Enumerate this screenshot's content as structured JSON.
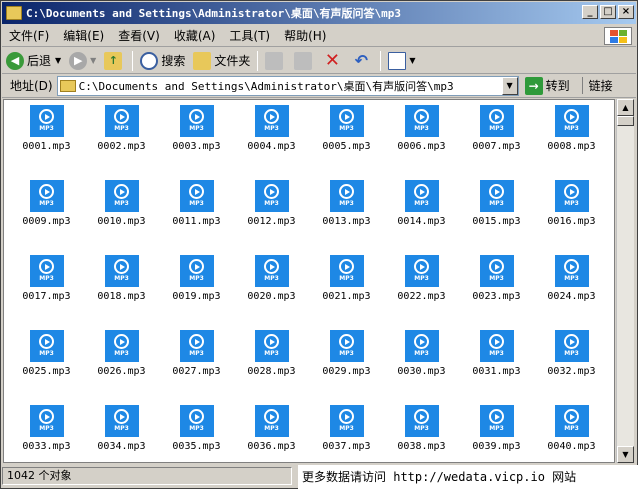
{
  "window": {
    "title": "C:\\Documents and Settings\\Administrator\\桌面\\有声版问答\\mp3",
    "buttons": [
      "_",
      "□",
      "×"
    ]
  },
  "menu": [
    "文件(F)",
    "编辑(E)",
    "查看(V)",
    "收藏(A)",
    "工具(T)",
    "帮助(H)"
  ],
  "toolbar": {
    "back": "后退",
    "search": "搜索",
    "folders": "文件夹"
  },
  "address": {
    "label": "地址(D)",
    "value": "C:\\Documents and Settings\\Administrator\\桌面\\有声版问答\\mp3",
    "go": "转到",
    "links": "链接"
  },
  "icon_label": "MP3",
  "files": [
    "0001.mp3",
    "0002.mp3",
    "0003.mp3",
    "0004.mp3",
    "0005.mp3",
    "0006.mp3",
    "0007.mp3",
    "0008.mp3",
    "0009.mp3",
    "0010.mp3",
    "0011.mp3",
    "0012.mp3",
    "0013.mp3",
    "0014.mp3",
    "0015.mp3",
    "0016.mp3",
    "0017.mp3",
    "0018.mp3",
    "0019.mp3",
    "0020.mp3",
    "0021.mp3",
    "0022.mp3",
    "0023.mp3",
    "0024.mp3",
    "0025.mp3",
    "0026.mp3",
    "0027.mp3",
    "0028.mp3",
    "0029.mp3",
    "0030.mp3",
    "0031.mp3",
    "0032.mp3",
    "0033.mp3",
    "0034.mp3",
    "0035.mp3",
    "0036.mp3",
    "0037.mp3",
    "0038.mp3",
    "0039.mp3",
    "0040.mp3"
  ],
  "status": {
    "count": "1042 个对象"
  },
  "watermark": "更多数据请访问 http://wedata.vicp.io 网站",
  "colors": {
    "title_start": "#0a246a",
    "title_end": "#a6caf0",
    "mp3_icon": "#1e88e5",
    "chrome": "#d4d0c8"
  }
}
